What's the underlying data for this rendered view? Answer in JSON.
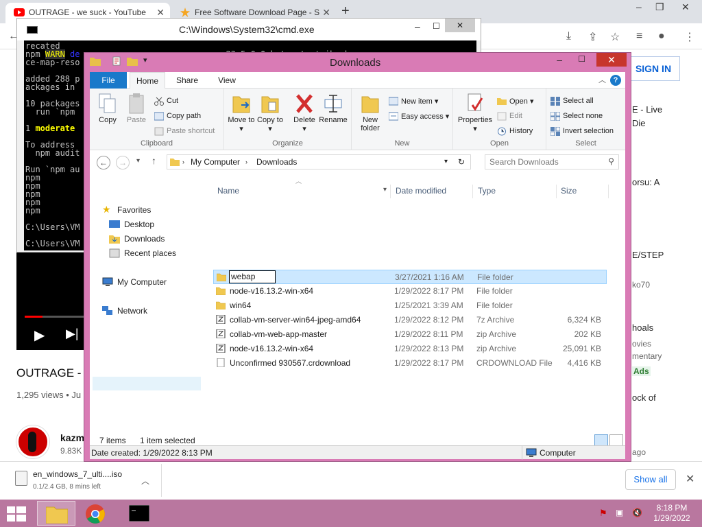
{
  "chrome": {
    "tabs": [
      {
        "title": "OUTRAGE - we suck - YouTube",
        "close": "✕"
      },
      {
        "title": "Free Software Download Page - S",
        "close": "✕"
      }
    ],
    "new_tab": "+",
    "sign_in": "SIGN IN",
    "right_snippets": [
      "E - Live",
      "Die",
      "orsu: A",
      "E/STEP",
      "ko70",
      "hoals",
      "ovies",
      "mentary",
      "Ads",
      "ock of",
      "ago"
    ],
    "colors": {
      "brand": "#ff0000",
      "link": "#065fd4"
    }
  },
  "youtube": {
    "title": "OUTRAGE - w",
    "views": "1,295 views • Ju",
    "channel": "kazm",
    "subs": "9.83K"
  },
  "downloads_shelf": {
    "file_name": "en_windows_7_ulti....iso",
    "status": "0.1/2.4 GB, 8 mins left",
    "show_all": "Show all"
  },
  "cmd": {
    "title": "C:\\Windows\\System32\\cmd.exe",
    "lines": [
      "recated",
      "npm ",
      "ce-map-reso",
      "",
      "added 288 p",
      "ackages in",
      "",
      "10 packages",
      "  run `npm",
      "",
      "1 ",
      "",
      "To address",
      "  npm audit",
      "",
      "Run `npm au",
      "npm ",
      "npm ",
      "npm ",
      "npm ",
      "npm ",
      "",
      "C:\\Users\\VM",
      "",
      "C:\\Users\\VM"
    ],
    "warn_word": "WARN",
    "warn_suffix": "de",
    "moderate": "moderate",
    "partial_right": "v 23.5.0 0 bytes test ihavh"
  },
  "explorer": {
    "title": "Downloads",
    "ribbon_tabs": [
      "File",
      "Home",
      "Share",
      "View"
    ],
    "clipboard": {
      "copy": "Copy",
      "paste": "Paste",
      "cut": "Cut",
      "copy_path": "Copy path",
      "paste_shortcut": "Paste shortcut",
      "label": "Clipboard"
    },
    "organize": {
      "move_to": "Move to ▾",
      "copy_to": "Copy to ▾",
      "delete": "Delete",
      "delete_arrow": "▾",
      "rename": "Rename",
      "label": "Organize"
    },
    "new": {
      "new_folder": "New folder",
      "new_item": "New item ▾",
      "easy_access": "Easy access ▾",
      "label": "New"
    },
    "open": {
      "properties": "Properties",
      "properties_arrow": "▾",
      "open": "Open ▾",
      "edit": "Edit",
      "history": "History",
      "label": "Open"
    },
    "select": {
      "select_all": "Select all",
      "select_none": "Select none",
      "invert": "Invert selection",
      "label": "Select"
    },
    "address": {
      "parts": [
        "My Computer",
        "Downloads"
      ],
      "search_placeholder": "Search Downloads"
    },
    "nav": {
      "favorites": "Favorites",
      "desktop": "Desktop",
      "downloads": "Downloads",
      "recent": "Recent places",
      "computer": "My Computer",
      "network": "Network"
    },
    "columns": [
      "Name",
      "Date modified",
      "Type",
      "Size"
    ],
    "files": [
      {
        "name": "webap",
        "date": "3/27/2021 1:16 AM",
        "type": "File folder",
        "size": ""
      },
      {
        "name": "node-v16.13.2-win-x64",
        "date": "1/29/2022 8:17 PM",
        "type": "File folder",
        "size": ""
      },
      {
        "name": "win64",
        "date": "1/25/2021 3:39 AM",
        "type": "File folder",
        "size": ""
      },
      {
        "name": "collab-vm-server-win64-jpeg-amd64",
        "date": "1/29/2022 8:12 PM",
        "type": "7z Archive",
        "size": "6,324 KB"
      },
      {
        "name": "collab-vm-web-app-master",
        "date": "1/29/2022 8:11 PM",
        "type": "zip Archive",
        "size": "202 KB"
      },
      {
        "name": "node-v16.13.2-win-x64",
        "date": "1/29/2022 8:13 PM",
        "type": "zip Archive",
        "size": "25,091 KB"
      },
      {
        "name": "Unconfirmed 930567.crdownload",
        "date": "1/29/2022 8:17 PM",
        "type": "CRDOWNLOAD File",
        "size": "4,416 KB"
      }
    ],
    "status": {
      "items": "7 items",
      "selected": "1 item selected"
    },
    "details": {
      "date_created": "Date created: 1/29/2022 8:13 PM",
      "location": "Computer"
    }
  },
  "taskbar": {
    "time": "8:18 PM",
    "date": "1/29/2022"
  }
}
